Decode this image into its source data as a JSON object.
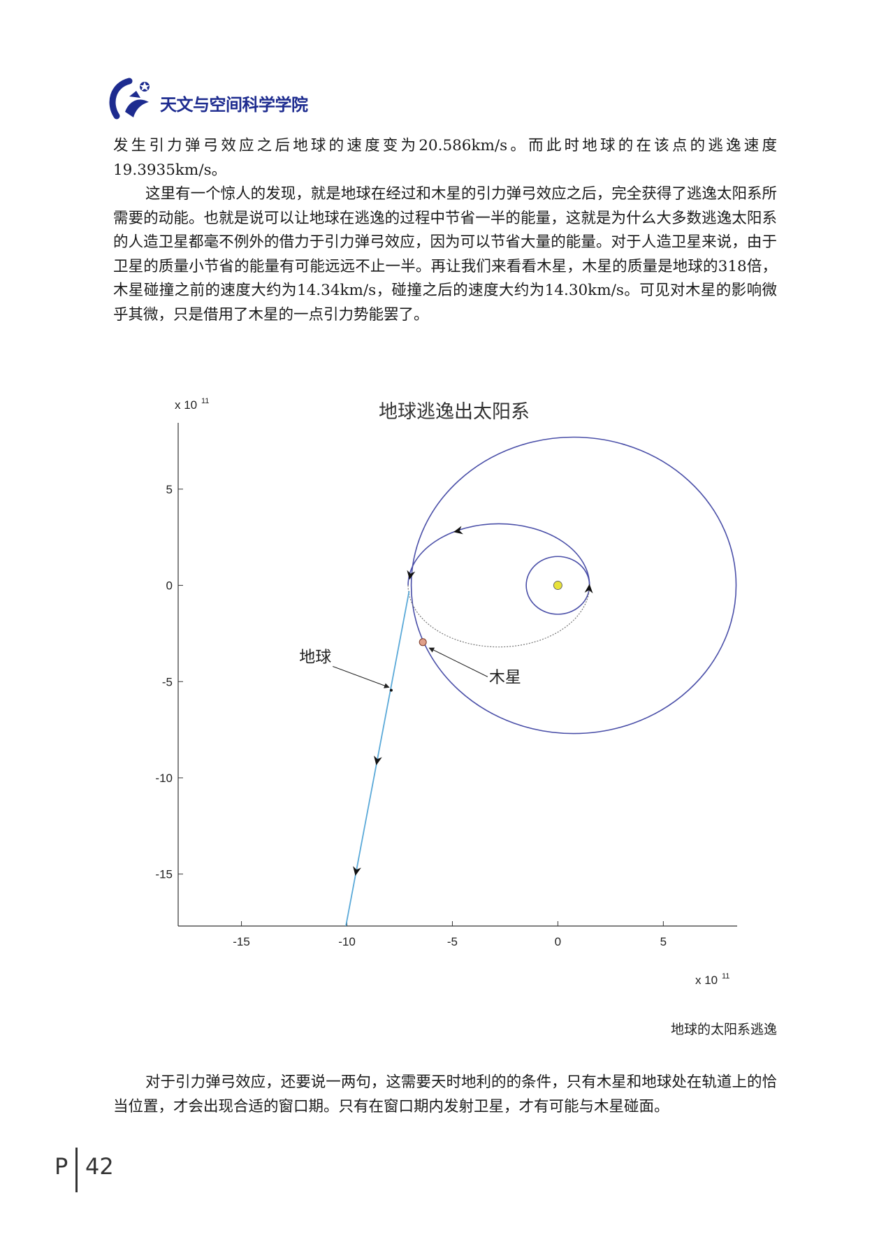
{
  "header": {
    "logo_text": "天文与空间科学学院",
    "colors": {
      "brand": "#1d2b8f"
    }
  },
  "body": {
    "para1": "发生引力弹弓效应之后地球的速度变为20.586km/s。而此时地球的在该点的逃逸速度19.3935km/s。",
    "para2": "这里有一个惊人的发现，就是地球在经过和木星的引力弹弓效应之后，完全获得了逃逸太阳系所需要的动能。也就是说可以让地球在逃逸的过程中节省一半的能量，这就是为什么大多数逃逸太阳系的人造卫星都毫不例外的借力于引力弹弓效应，因为可以节省大量的能量。对于人造卫星来说，由于卫星的质量小节省的能量有可能远远不止一半。再让我们来看看木星，木星的质量是地球的318倍，木星碰撞之前的速度大约为14.34km/s，碰撞之后的速度大约为14.30km/s。可见对木星的影响微乎其微，只是借用了木星的一点引力势能罢了。",
    "para3": "对于引力弹弓效应，还要说一两句，这需要天时地利的的条件，只有木星和地球处在轨道上的恰当位置，才会出现合适的窗口期。只有在窗口期内发射卫星，才有可能与木星碰面。"
  },
  "figure": {
    "caption": "地球的太阳系逃逸"
  },
  "chart_data": {
    "type": "line",
    "title": "地球逃逸出太阳系",
    "xlabel": "",
    "ylabel": "",
    "x_multiplier": "x 10",
    "x_exponent": "11",
    "y_multiplier": "x 10",
    "y_exponent": "11",
    "xlim": [
      -18,
      8.5
    ],
    "ylim": [
      -17.7,
      7.9
    ],
    "xticks": [
      -15,
      -10,
      -5,
      0,
      5
    ],
    "xtick_labels": [
      "-15",
      "-10",
      "-5",
      "0",
      "5"
    ],
    "yticks": [
      5,
      0,
      -5,
      -10,
      -15
    ],
    "ytick_labels": [
      "5",
      "0",
      "-5",
      "-10",
      "-15"
    ],
    "grid": false,
    "colors": {
      "orbit": "#4a4fa8",
      "escape": "#5aa9d8",
      "sun": "#e8e23a",
      "jupiter": "#e0a08a"
    },
    "sun": {
      "x": 0,
      "y": 0
    },
    "earth_orbit": {
      "cx": 0,
      "cy": 0,
      "r": 1.5
    },
    "jupiter_orbit": {
      "cx": 0.75,
      "cy": 0,
      "r": 7.7
    },
    "transfer_ellipse": {
      "cx": -2.8,
      "cy": 0,
      "rx": 4.3,
      "ry": 3.2
    },
    "escape_path": [
      {
        "x": -7.05,
        "y": -0.3
      },
      {
        "x": -10.05,
        "y": -17.7
      }
    ],
    "earth_point": {
      "x": -7.9,
      "y": -5.45
    },
    "jupiter_point": {
      "x": -6.4,
      "y": -2.95
    },
    "annotations": [
      {
        "text": "地球",
        "x": -11.5,
        "y": -3.7,
        "arrow_to": {
          "x": -8.0,
          "y": -5.3
        }
      },
      {
        "text": "木星",
        "x": -2.5,
        "y": -4.75,
        "arrow_to": {
          "x": -6.1,
          "y": -3.25
        }
      }
    ]
  },
  "footer": {
    "letter": "P",
    "page_number": "42"
  }
}
